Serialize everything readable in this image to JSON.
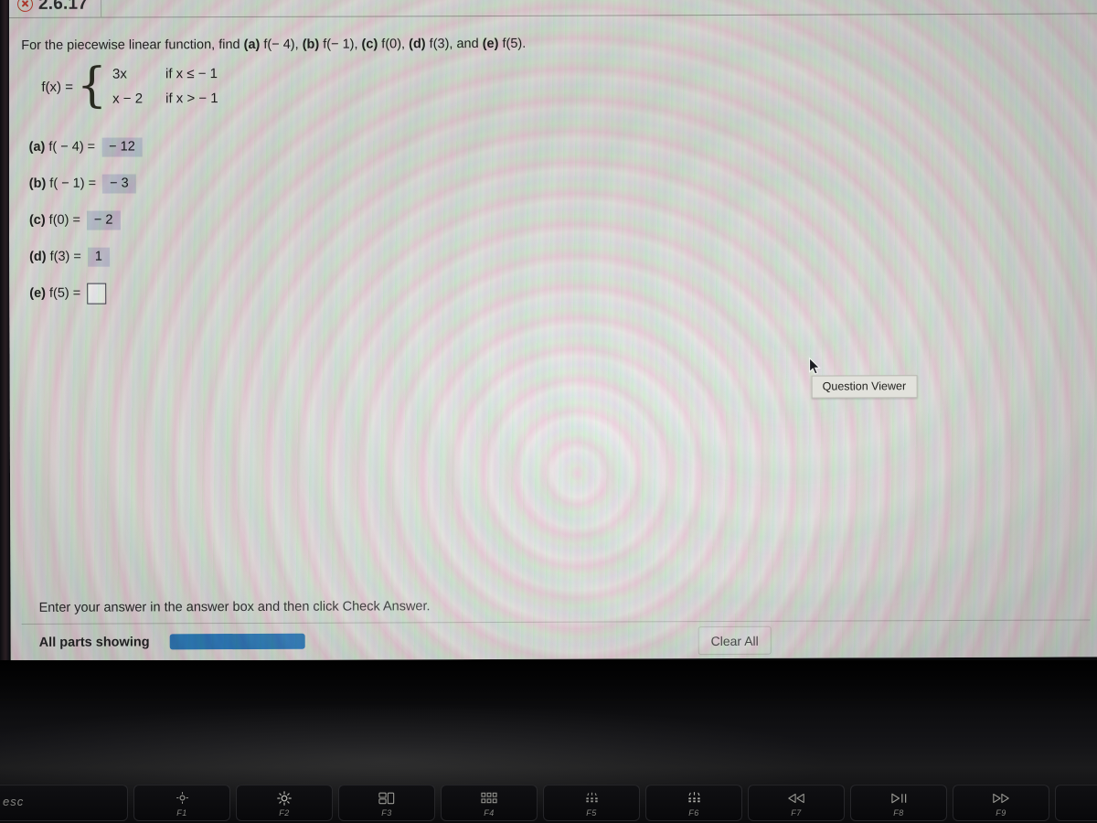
{
  "app": {
    "tab_label": "2.6.17",
    "tab_icon": "red-circle-x-icon"
  },
  "question": {
    "prompt_prefix": "For the piecewise linear function, find ",
    "prompt_parts": [
      {
        "label": "(a)",
        "expr": " f(− 4), "
      },
      {
        "label": "(b)",
        "expr": " f(− 1), "
      },
      {
        "label": "(c)",
        "expr": " f(0), "
      },
      {
        "label": "(d)",
        "expr": " f(3), and "
      },
      {
        "label": "(e)",
        "expr": " f(5)."
      }
    ],
    "function_label": "f(x) =",
    "cases": [
      {
        "expr": "3x",
        "condition": "if x ≤ − 1"
      },
      {
        "expr": "x − 2",
        "condition": "if x > − 1"
      }
    ]
  },
  "answers": [
    {
      "label": "(a)",
      "equation": "f( − 4) =",
      "value": "− 12",
      "filled": true
    },
    {
      "label": "(b)",
      "equation": "f( − 1) =",
      "value": "− 3",
      "filled": true
    },
    {
      "label": "(c)",
      "equation": "f(0) =",
      "value": "− 2",
      "filled": true
    },
    {
      "label": "(d)",
      "equation": "f(3) =",
      "value": "1",
      "filled": true
    },
    {
      "label": "(e)",
      "equation": "f(5) =",
      "value": "",
      "filled": false
    }
  ],
  "footer": {
    "note": "Enter your answer in the answer box and then click Check Answer.",
    "all_parts_label": "All parts showing",
    "progress_percent": 100,
    "progress_color": "#2b78b6",
    "clear_all_label": "Clear All"
  },
  "tooltip": {
    "text": "Question Viewer"
  },
  "keyboard": {
    "keys": [
      {
        "label": "esc",
        "glyph": "escape-key"
      },
      {
        "label": "F1",
        "glyph": "brightness-down-icon"
      },
      {
        "label": "F2",
        "glyph": "brightness-up-icon"
      },
      {
        "label": "F3",
        "glyph": "mission-control-icon"
      },
      {
        "label": "F4",
        "glyph": "launchpad-icon"
      },
      {
        "label": "F5",
        "glyph": "keyboard-backlight-down-icon"
      },
      {
        "label": "F6",
        "glyph": "keyboard-backlight-up-icon"
      },
      {
        "label": "F7",
        "glyph": "rewind-icon"
      },
      {
        "label": "F8",
        "glyph": "play-pause-icon"
      },
      {
        "label": "F9",
        "glyph": "fast-forward-icon"
      }
    ]
  }
}
